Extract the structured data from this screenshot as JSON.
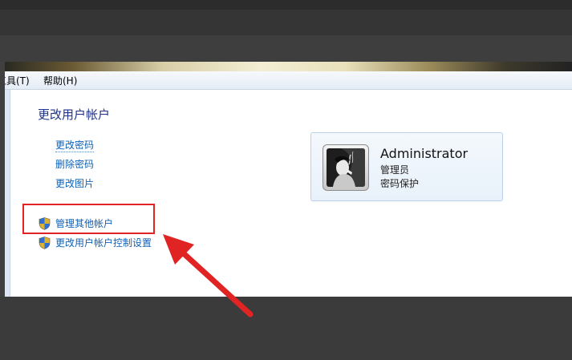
{
  "menubar": {
    "items": [
      {
        "label": "工具(T)"
      },
      {
        "label": "帮助(H)"
      }
    ]
  },
  "page": {
    "title": "更改用户帐户"
  },
  "tasks": [
    {
      "label": "更改密码"
    },
    {
      "label": "删除密码"
    },
    {
      "label": "更改图片"
    }
  ],
  "shield_tasks": [
    {
      "label": "管理其他帐户",
      "icon": "uac-shield-icon"
    },
    {
      "label": "更改用户帐户控制设置",
      "icon": "uac-shield-icon"
    }
  ],
  "user_card": {
    "name": "Administrator",
    "role": "管理员",
    "status": "密码保护",
    "avatar": "user-picture"
  },
  "annotation": {
    "box_color": "#e02323",
    "arrow_color": "#e02323"
  },
  "colors": {
    "link": "#0e62b7",
    "title": "#1e3287"
  }
}
